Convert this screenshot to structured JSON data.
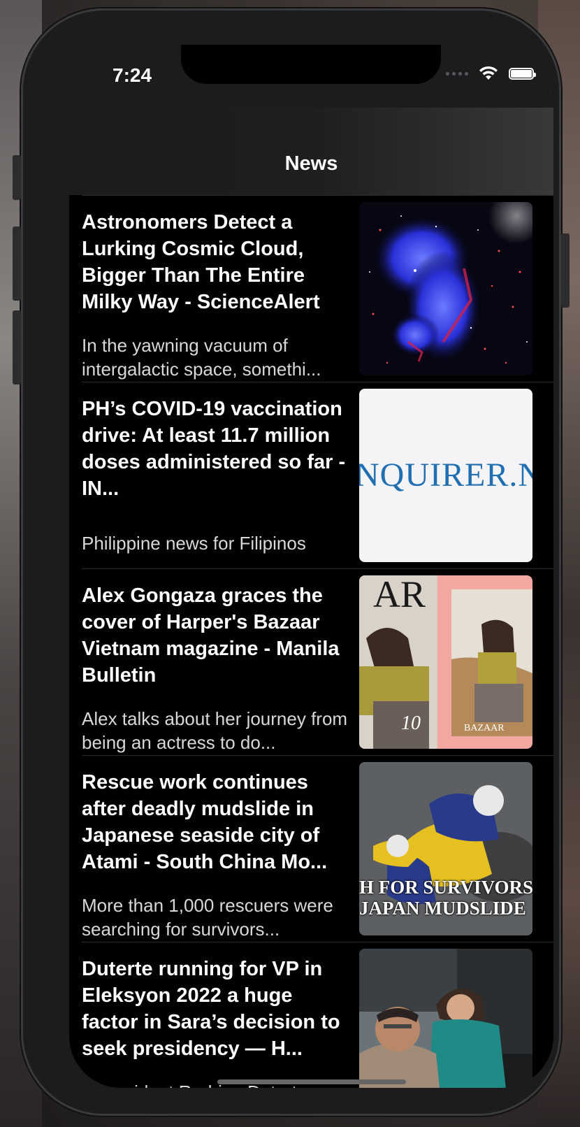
{
  "status_bar": {
    "time": "7:24"
  },
  "nav": {
    "title": "News"
  },
  "articles": [
    {
      "headline": "Astronomers Detect a Lurking Cosmic Cloud, Bigger Than The Entire Milky Way - ScienceAlert",
      "summary": "In the yawning vacuum of intergalactic space, somethi...",
      "image_alt": "cosmic-cloud-image"
    },
    {
      "headline": "PH’s COVID-19 vaccination drive: At least 11.7 million doses administered so far - IN...",
      "summary": "Philippine news for Filipinos",
      "image_text": "NQUIRER.NE"
    },
    {
      "headline": "Alex Gongaza graces the cover of Harper's Bazaar Vietnam magazine - Manila Bulletin",
      "summary": "Alex talks about her journey from being an actress to do...",
      "image_alt": "magazine-cover-image"
    },
    {
      "headline": "Rescue work continues after deadly mudslide in Japanese seaside city of Atami - South China Mo...",
      "summary": "More than 1,000 rescuers were searching for survivors...",
      "image_caption_1": "H FOR SURVIVORS",
      "image_caption_2": "JAPAN MUDSLIDE"
    },
    {
      "headline": "Duterte running for VP in Eleksyon 2022 a huge factor in Sara’s decision to seek presidency — H...",
      "summary": "If President Rodrigo Duterte decides to run for vice presi...",
      "image_alt": "duterte-car-image"
    }
  ]
}
